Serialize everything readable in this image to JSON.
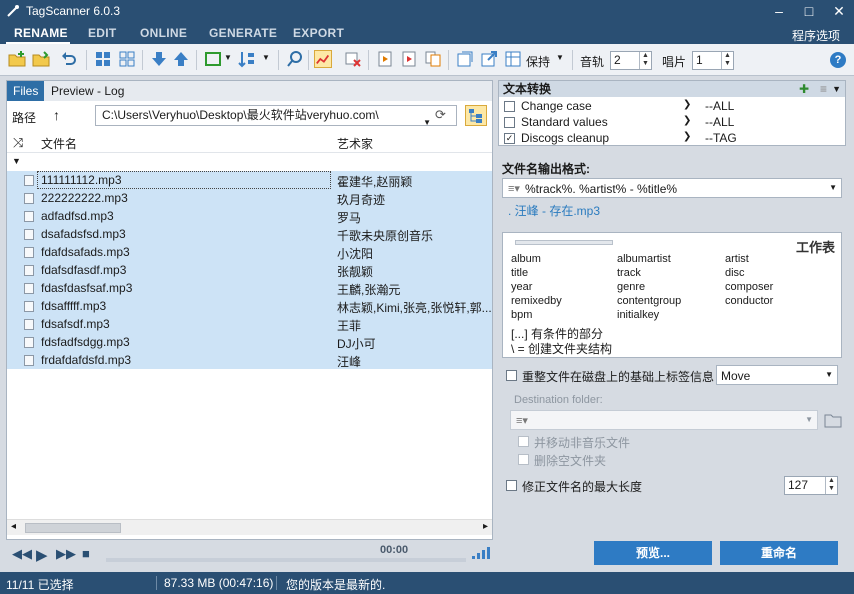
{
  "window": {
    "title": "TagScanner 6.0.3",
    "minimize": "–",
    "maximize": "□",
    "close": "✕"
  },
  "menu": {
    "tabs": [
      {
        "label": "RENAME"
      },
      {
        "label": "EDIT"
      },
      {
        "label": "ONLINE"
      },
      {
        "label": "GENERATE"
      },
      {
        "label": "EXPORT"
      }
    ],
    "options_label": "程序选项"
  },
  "toolbar": {
    "keep_label": "保持",
    "track_label": "音轨",
    "track_value": "2",
    "disc_label": "唱片",
    "disc_value": "1",
    "help": "?"
  },
  "browser": {
    "tabs": [
      "Files",
      "Preview - Log"
    ],
    "path_label": "路径",
    "path_value": "C:\\Users\\Veryhuo\\Desktop\\最火软件站veryhuo.com\\",
    "columns": {
      "filename": "文件名",
      "artist": "艺术家"
    },
    "rows": [
      {
        "filename": "111111112.mp3",
        "artist": "霍建华,赵丽颖"
      },
      {
        "filename": "222222222.mp3",
        "artist": "玖月奇迹"
      },
      {
        "filename": "adfadfsd.mp3",
        "artist": "罗马"
      },
      {
        "filename": "dsafadsfsd.mp3",
        "artist": "千歌未央原创音乐"
      },
      {
        "filename": "fdafdsafads.mp3",
        "artist": "小沈阳"
      },
      {
        "filename": "fdafsdfasdf.mp3",
        "artist": "张靓颖"
      },
      {
        "filename": "fdasfdasfsaf.mp3",
        "artist": "王麟,张瀚元"
      },
      {
        "filename": "fdsafffff.mp3",
        "artist": "林志颖,Kimi,张亮,张悦轩,郭..."
      },
      {
        "filename": "fdsafsdf.mp3",
        "artist": "王菲"
      },
      {
        "filename": "fdsfadfsdgg.mp3",
        "artist": "DJ小可"
      },
      {
        "filename": "frdafdafdsfd.mp3",
        "artist": "汪峰"
      }
    ]
  },
  "player": {
    "time": "00:00"
  },
  "text_transform": {
    "title": "文本转换",
    "items": [
      {
        "name": "Change case",
        "value": "--ALL",
        "checked": false
      },
      {
        "name": "Standard values",
        "value": "--ALL",
        "checked": false
      },
      {
        "name": "Discogs cleanup",
        "value": "--TAG",
        "checked": true
      }
    ]
  },
  "format": {
    "title": "文件名输出格式:",
    "value": "%track%. %artist% - %title%",
    "preview": ". 汪峰 - 存在.mp3"
  },
  "worksheet": {
    "title": "工作表",
    "fields": [
      "album",
      "albumartist",
      "artist",
      "title",
      "track",
      "disc",
      "year",
      "genre",
      "composer",
      "remixedby",
      "contentgroup",
      "conductor",
      "bpm",
      "initialkey"
    ],
    "hint1": "[...] 有条件的部分",
    "hint2": "\\ = 创建文件夹结构"
  },
  "options": {
    "reorganize_label": "重整文件在磁盘上的基础上标签信息",
    "mode_value": "Move",
    "dest_label": "Destination folder:",
    "move_non_music": "并移动非音乐文件",
    "delete_empty": "删除空文件夹",
    "maxlen_label": "修正文件名的最大长度",
    "maxlen_value": "127"
  },
  "actions": {
    "preview": "预览...",
    "rename": "重命名"
  },
  "status": {
    "selected": "11/11 已选择",
    "size": "87.33 MB (00:47:16)",
    "version": "您的版本是最新的."
  }
}
